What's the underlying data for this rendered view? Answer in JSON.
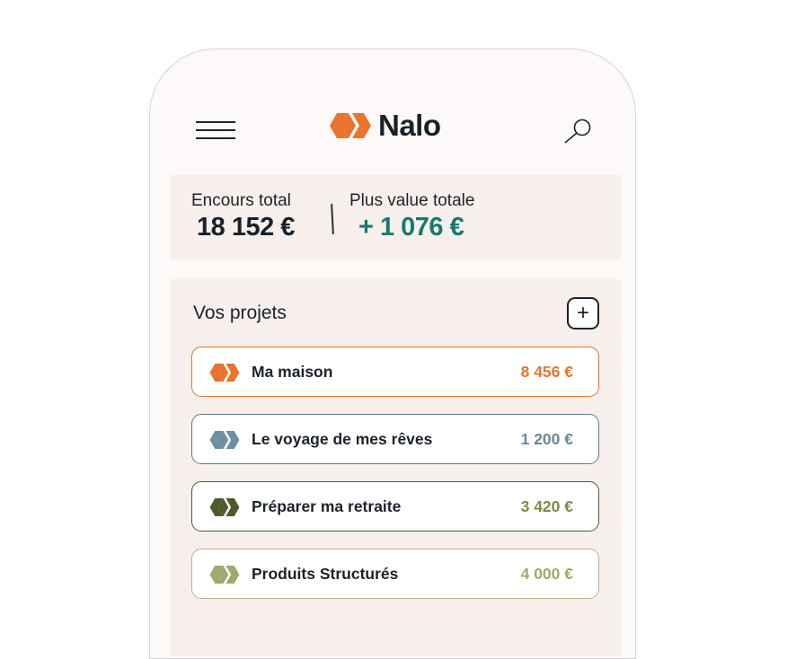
{
  "header": {
    "brand": "Nalo"
  },
  "summary": {
    "total_label": "Encours total",
    "total_value": "18 152 €",
    "gain_label": "Plus value totale",
    "gain_value": "+ 1 076 €"
  },
  "projects": {
    "title": "Vos projets",
    "add_label": "+",
    "items": [
      {
        "name": "Ma maison",
        "amount": "8 456 €",
        "color": "#e8742e",
        "amount_color": "#e8742e",
        "border": "#e8742e"
      },
      {
        "name": "Le voyage de mes rêves",
        "amount": "1 200 €",
        "color": "#6d8fa0",
        "amount_color": "#6b8796",
        "border": "#5f7b89"
      },
      {
        "name": "Préparer ma retraite",
        "amount": "3 420 €",
        "color": "#4e5a2c",
        "amount_color": "#7e8a46",
        "border": "#4e5a2c"
      },
      {
        "name": "Produits Structurés",
        "amount": "4 000 €",
        "color": "#a3a86b",
        "amount_color": "#a3a86b",
        "border": "#b4b58a"
      }
    ]
  },
  "colors": {
    "accent": "#e8742e",
    "positive": "#177a6e",
    "panel": "#f6efec",
    "phone_bg": "#fcf9f8"
  },
  "icons": {
    "menu": "hamburger-icon",
    "search": "search-icon",
    "logo": "nalo-logo-icon",
    "add": "plus-icon"
  }
}
